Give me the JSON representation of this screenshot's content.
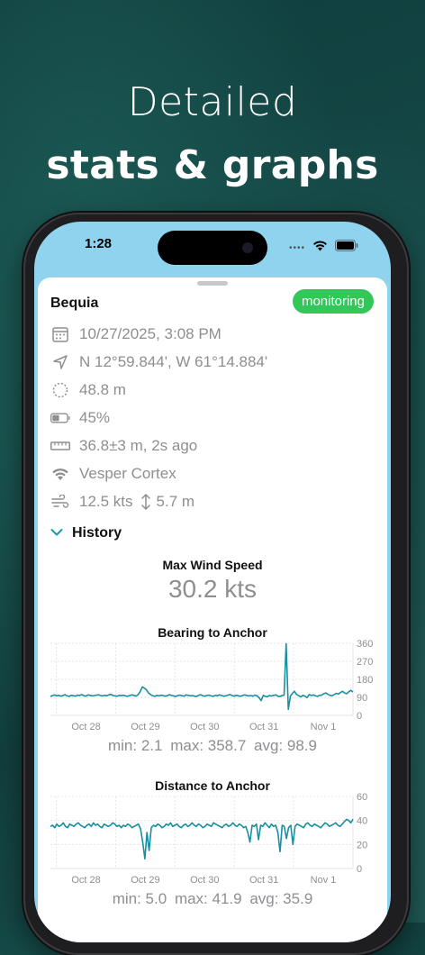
{
  "headline": {
    "line1": "Detailed",
    "line2": "stats & graphs"
  },
  "status_bar": {
    "time": "1:28"
  },
  "vessel": {
    "name": "Bequia",
    "status": "monitoring",
    "details": {
      "datetime": "10/27/2025, 3:08 PM",
      "position": "N 12°59.844', W 61°14.884'",
      "radius": "48.8 m",
      "battery": "45%",
      "distance": "36.8±3 m, 2s ago",
      "network": "Vesper Cortex",
      "wind": "12.5 kts",
      "depth": "5.7 m"
    }
  },
  "history": {
    "label": "History",
    "max_wind_label": "Max Wind Speed",
    "max_wind_value": "30.2 kts"
  },
  "chart_data": [
    {
      "type": "line",
      "title": "Bearing to Anchor",
      "categories": [
        "Oct 28",
        "Oct 29",
        "Oct 30",
        "Oct 31",
        "Nov 1"
      ],
      "ylim": [
        0,
        360
      ],
      "yticks": [
        0,
        90,
        180,
        270,
        360
      ],
      "series": [
        {
          "color": "#1a8fa0",
          "values": [
            95,
            98,
            102,
            97,
            100,
            96,
            99,
            103,
            97,
            95,
            100,
            98,
            96,
            101,
            99,
            104,
            98,
            96,
            102,
            100,
            97,
            99,
            101,
            103,
            99,
            97,
            100,
            98,
            102,
            105,
            99,
            97,
            96,
            100,
            98,
            101,
            97,
            95,
            99,
            102,
            100,
            96,
            103,
            118,
            142,
            136,
            128,
            112,
            104,
            98,
            95,
            100,
            97,
            101,
            99,
            96,
            98,
            103,
            100,
            97,
            94,
            99,
            101,
            98,
            96,
            102,
            100,
            97,
            99,
            96,
            94,
            100,
            103,
            98,
            96,
            99,
            101,
            97,
            95,
            100,
            98,
            102,
            99,
            96,
            97,
            101,
            104,
            99,
            96,
            100,
            98,
            95,
            99,
            102,
            100,
            97,
            99,
            96,
            101,
            98,
            88,
            74,
            100,
            95,
            93,
            99,
            97,
            100,
            102,
            96,
            94,
            99,
            101,
            358,
            30,
            96,
            110,
            120,
            104,
            98,
            92,
            100,
            96,
            88,
            104,
            99,
            102,
            97,
            95,
            100,
            101,
            108,
            112,
            105,
            100,
            98,
            104,
            110,
            106,
            114,
            120,
            112,
            108,
            118,
            125,
            116
          ]
        }
      ],
      "summary": {
        "min": "min: 2.1",
        "max": "max: 358.7",
        "avg": "avg: 98.9"
      }
    },
    {
      "type": "line",
      "title": "Distance to Anchor",
      "categories": [
        "Oct 28",
        "Oct 29",
        "Oct 30",
        "Oct 31",
        "Nov 1"
      ],
      "ylim": [
        0,
        60
      ],
      "yticks": [
        0,
        20,
        40,
        60
      ],
      "series": [
        {
          "color": "#1a8fa0",
          "values": [
            35,
            36,
            34,
            37,
            35,
            36,
            38,
            35,
            34,
            37,
            36,
            35,
            37,
            38,
            36,
            35,
            34,
            36,
            37,
            35,
            38,
            36,
            37,
            35,
            34,
            37,
            36,
            35,
            36,
            38,
            37,
            35,
            36,
            34,
            36,
            35,
            37,
            36,
            34,
            35,
            36,
            37,
            33,
            22,
            8,
            30,
            15,
            34,
            36,
            35,
            37,
            36,
            34,
            35,
            37,
            36,
            38,
            35,
            36,
            37,
            35,
            34,
            36,
            37,
            35,
            36,
            38,
            36,
            35,
            37,
            36,
            34,
            35,
            37,
            36,
            35,
            38,
            37,
            36,
            35,
            34,
            36,
            37,
            35,
            36,
            38,
            36,
            35,
            37,
            36,
            34,
            35,
            30,
            22,
            36,
            35,
            37,
            24,
            36,
            35,
            38,
            36,
            34,
            37,
            35,
            36,
            30,
            14,
            36,
            35,
            25,
            34,
            36,
            20,
            35,
            37,
            36,
            35,
            34,
            37,
            38,
            36,
            35,
            37,
            36,
            35,
            34,
            36,
            38,
            37,
            35,
            36,
            37,
            38,
            36,
            35,
            37,
            39,
            41,
            40,
            38,
            41
          ]
        }
      ],
      "summary": {
        "min": "min: 5.0",
        "max": "max: 41.9",
        "avg": "avg: 35.9"
      }
    }
  ]
}
